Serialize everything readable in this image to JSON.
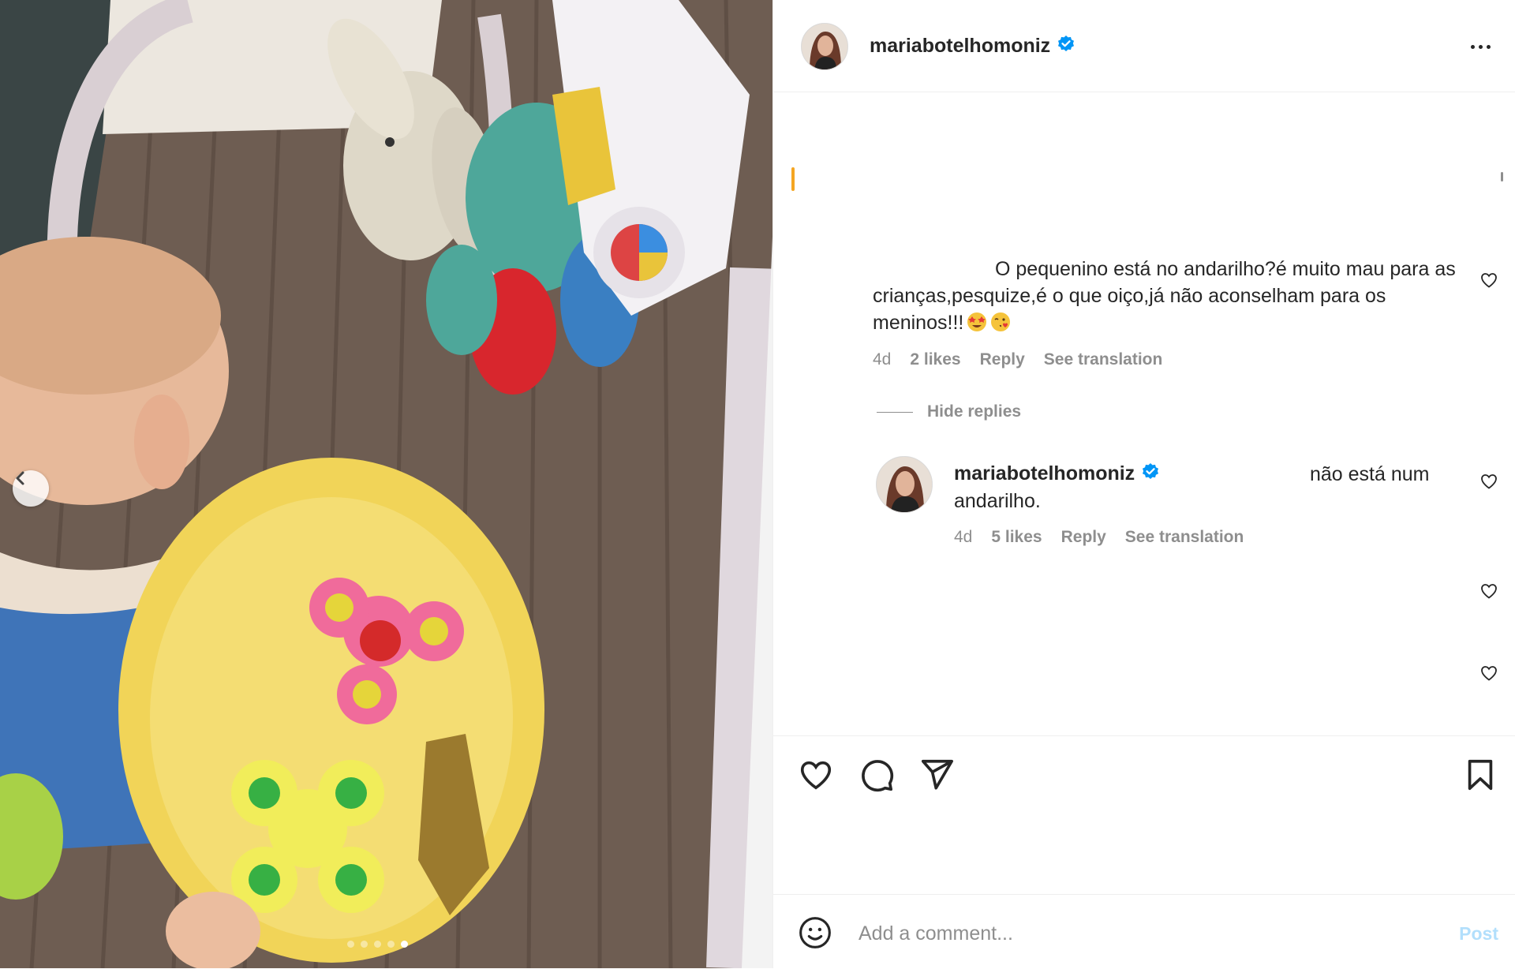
{
  "post": {
    "username": "mariabotelhomoniz",
    "verified": true,
    "more_icon": "more-horizontal-icon",
    "carousel": {
      "count": 5,
      "active_index": 4
    }
  },
  "comments": [
    {
      "text": "O pequenino está no andarilho?é muito mau para as crianças,pesquize,é o que oiço,já não aconselham para os meninos!!!",
      "emojis": [
        "star-struck-emoji",
        "face-blowing-kiss-emoji"
      ],
      "age": "4d",
      "likes": "2 likes",
      "reply_label": "Reply",
      "translate_label": "See translation"
    }
  ],
  "hide_replies_label": "Hide replies",
  "replies": [
    {
      "username": "mariabotelhomoniz",
      "verified": true,
      "text_a": "não está num",
      "text_b": "andarilho.",
      "age": "4d",
      "likes": "5 likes",
      "reply_label": "Reply",
      "translate_label": "See translation"
    }
  ],
  "actions": {
    "like_icon": "heart-icon",
    "comment_icon": "comment-icon",
    "share_icon": "send-icon",
    "save_icon": "bookmark-icon"
  },
  "composer": {
    "placeholder": "Add a comment...",
    "post_label": "Post",
    "emoji_icon": "emoji-icon"
  },
  "colors": {
    "verified": "#0095f6",
    "text": "#262626",
    "secondary": "#8e8e8e",
    "post_disabled": "#b2dffc"
  }
}
